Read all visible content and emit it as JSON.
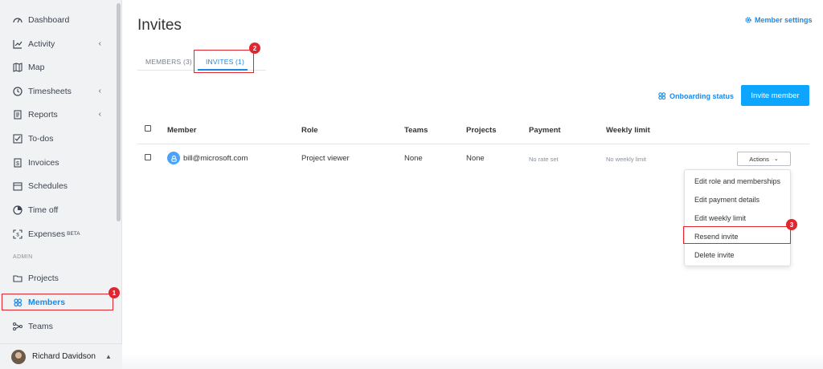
{
  "sidebar": {
    "items": [
      {
        "label": "Dashboard",
        "icon": "dashboard-icon",
        "chevron": false
      },
      {
        "label": "Activity",
        "icon": "activity-chart-icon",
        "chevron": true
      },
      {
        "label": "Map",
        "icon": "map-icon",
        "chevron": false
      },
      {
        "label": "Timesheets",
        "icon": "clock-icon",
        "chevron": true
      },
      {
        "label": "Reports",
        "icon": "report-icon",
        "chevron": true
      },
      {
        "label": "To-dos",
        "icon": "checkbox-icon",
        "chevron": false
      },
      {
        "label": "Invoices",
        "icon": "invoice-icon",
        "chevron": false
      },
      {
        "label": "Schedules",
        "icon": "calendar-icon",
        "chevron": false
      },
      {
        "label": "Time off",
        "icon": "pie-icon",
        "chevron": false
      }
    ],
    "expenses": {
      "label": "Expenses",
      "badge": "BETA"
    },
    "admin_label": "ADMIN",
    "admin_items": [
      {
        "label": "Projects",
        "icon": "folder-icon"
      },
      {
        "label": "Members",
        "icon": "members-icon",
        "active": true
      },
      {
        "label": "Teams",
        "icon": "teams-icon"
      }
    ],
    "user": {
      "name": "Richard Davidson",
      "caret": "▲"
    }
  },
  "header": {
    "title": "Invites",
    "settings_label": "Member settings"
  },
  "tabs": [
    {
      "label": "MEMBERS (3)",
      "active": false
    },
    {
      "label": "INVITES (1)",
      "active": true
    }
  ],
  "toolbar": {
    "onboarding_label": "Onboarding status",
    "invite_label": "Invite member"
  },
  "table": {
    "columns": [
      "Member",
      "Role",
      "Teams",
      "Projects",
      "Payment",
      "Weekly limit"
    ],
    "rows": [
      {
        "member": "bill@microsoft.com",
        "role": "Project viewer",
        "teams": "None",
        "projects": "None",
        "payment": "No rate set",
        "weekly_limit": "No weekly limit"
      }
    ]
  },
  "actions": {
    "button_label": "Actions",
    "menu": [
      "Edit role and memberships",
      "Edit payment details",
      "Edit weekly limit",
      "Resend invite",
      "Delete invite"
    ]
  },
  "annotations": [
    "1",
    "2",
    "3"
  ],
  "colors": {
    "accent": "#1e88e5",
    "button": "#0ea5ff",
    "highlight": "#e0262f"
  }
}
